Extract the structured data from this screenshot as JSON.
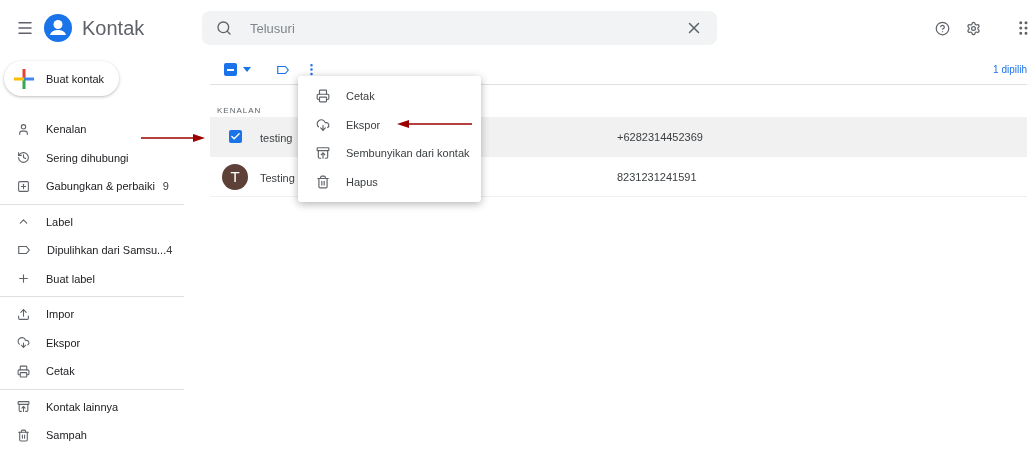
{
  "app": {
    "title": "Kontak"
  },
  "search": {
    "placeholder": "Telusuri"
  },
  "create_button": {
    "label": "Buat kontak"
  },
  "sidebar": {
    "sections": [
      {
        "items": [
          {
            "kind": "item",
            "label": "Kenalan"
          },
          {
            "kind": "item",
            "label": "Sering dihubungi"
          },
          {
            "kind": "item",
            "label": "Gabungkan & perbaiki",
            "count": "9"
          }
        ]
      },
      {
        "items": [
          {
            "kind": "header",
            "label": "Label",
            "expanded": true
          },
          {
            "kind": "item",
            "label": "Dipulihkan dari Samsu...",
            "count": "4"
          },
          {
            "kind": "item",
            "label": "Buat label"
          }
        ]
      },
      {
        "items": [
          {
            "kind": "item",
            "label": "Impor"
          },
          {
            "kind": "item",
            "label": "Ekspor"
          },
          {
            "kind": "item",
            "label": "Cetak"
          }
        ]
      },
      {
        "items": [
          {
            "kind": "item",
            "label": "Kontak lainnya"
          },
          {
            "kind": "item",
            "label": "Sampah"
          }
        ]
      }
    ]
  },
  "toolbar": {
    "select_all_indeterminate": true,
    "selection_count": "1 dipilih"
  },
  "list": {
    "section": "KENALAN",
    "rows": [
      {
        "name": "testing",
        "phone": "+6282314452369",
        "selected": true
      },
      {
        "name": "Testing",
        "phone": "8231231241591",
        "selected": false,
        "avatar": "T"
      }
    ]
  },
  "menu": {
    "items": [
      "Cetak",
      "Ekspor",
      "Sembunyikan dari kontak",
      "Hapus"
    ]
  }
}
